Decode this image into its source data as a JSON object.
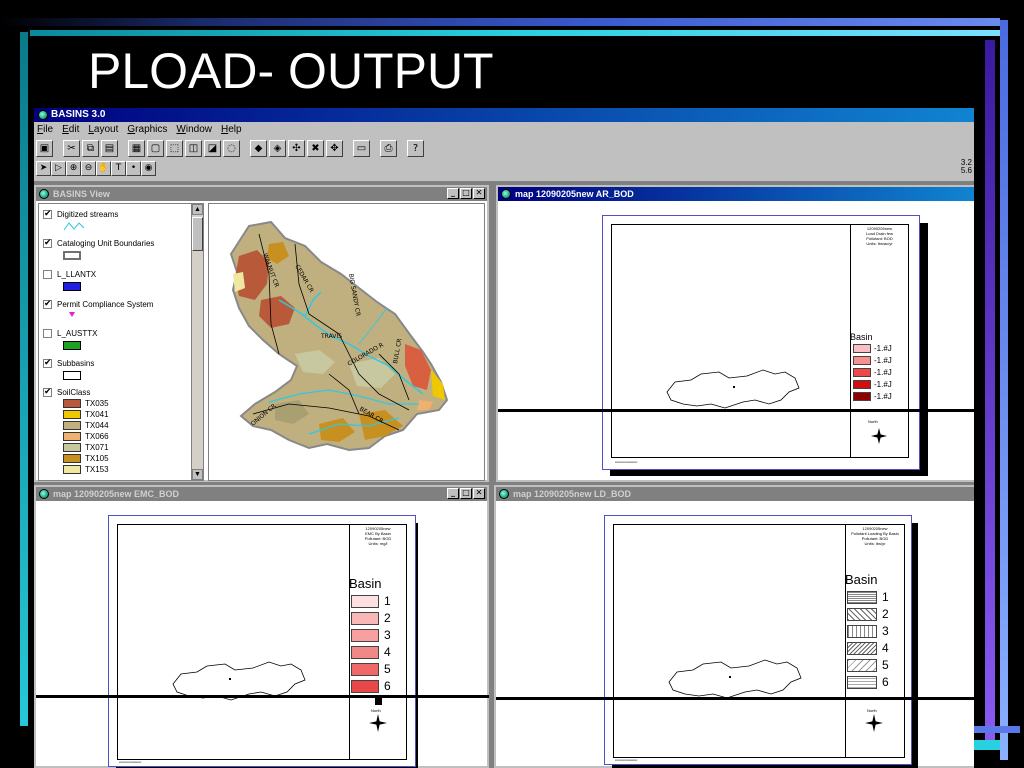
{
  "slide": {
    "title": "PLOAD- OUTPUT"
  },
  "app": {
    "title": "BASINS 3.0",
    "menu": [
      "File",
      "Edit",
      "Layout",
      "Graphics",
      "Window",
      "Help"
    ],
    "coords": [
      "3.2",
      "5.6"
    ]
  },
  "basins_view": {
    "title": "BASINS View",
    "layers": [
      {
        "label": "Digitized streams",
        "checked": true
      },
      {
        "label": "Cataloging Unit Boundaries",
        "checked": true
      },
      {
        "label": "L_LLANTX",
        "checked": false
      },
      {
        "label": "Permit Compliance System",
        "checked": true
      },
      {
        "label": "L_AUSTTX",
        "checked": false
      },
      {
        "label": "Subbasins",
        "checked": true
      },
      {
        "label": "SoilClass",
        "checked": true
      }
    ],
    "soil_classes": [
      {
        "name": "TX035",
        "color": "#b85a3a"
      },
      {
        "name": "TX041",
        "color": "#f0c800"
      },
      {
        "name": "TX044",
        "color": "#c0b080"
      },
      {
        "name": "TX066",
        "color": "#f0b070"
      },
      {
        "name": "TX071",
        "color": "#c8c8a0"
      },
      {
        "name": "TX105",
        "color": "#c89020"
      },
      {
        "name": "TX153",
        "color": "#f0e8a0"
      }
    ],
    "map_labels": [
      "WALNUT CR",
      "TRAVIS",
      "BULL CR",
      "COLORADO R",
      "BEAR CR",
      "ONION CR",
      "CEDAR CR",
      "BIG SANDY CR"
    ]
  },
  "map_ar": {
    "title": "map 12090205new AR_BOD",
    "header_text": [
      "12090205new",
      "Load Drain few",
      "Pollutant: BOD",
      "Units: lbs/ac/yr"
    ],
    "legend_title": "Basin",
    "legend_items": [
      "-1.#J",
      "-1.#J",
      "-1.#J",
      "-1.#J",
      "-1.#J"
    ],
    "legend_colors": [
      "#f8c0c0",
      "#f89090",
      "#f04848",
      "#d01010",
      "#900000"
    ],
    "north_label": "North"
  },
  "map_emc": {
    "title": "map 12090205new EMC_BOD",
    "header_text": [
      "12090205new",
      "EMC By Basin",
      "Pollutant: BOD",
      "Units: mg/l"
    ],
    "legend_title": "Basin",
    "legend_items": [
      "1",
      "2",
      "3",
      "4",
      "5",
      "6"
    ],
    "legend_colors": [
      "#fde0e0",
      "#f8b8b8",
      "#f8a0a0",
      "#f08888",
      "#f06868",
      "#e84848"
    ],
    "north_label": "North"
  },
  "map_ld": {
    "title": "map 12090205new LD_BOD",
    "header_text": [
      "12090205new",
      "Pollutant Loading By Basin",
      "Pollutant: BOD",
      "Units: lbs/yr"
    ],
    "legend_title": "Basin",
    "legend_items": [
      "1",
      "2",
      "3",
      "4",
      "5",
      "6"
    ],
    "north_label": "North"
  }
}
